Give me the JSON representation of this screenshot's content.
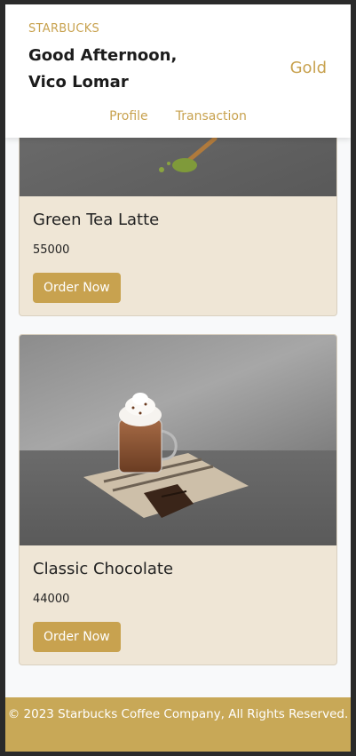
{
  "header": {
    "brand": "STARBUCKS",
    "greeting_line1": "Good Afternoon,",
    "greeting_line2": "Vico Lomar",
    "tier": "Gold",
    "nav": {
      "profile": "Profile",
      "transaction": "Transaction"
    }
  },
  "products": [
    {
      "name": "Green Tea Latte",
      "price": "55000",
      "button": "Order Now"
    },
    {
      "name": "Classic Chocolate",
      "price": "44000",
      "button": "Order Now"
    }
  ],
  "footer": {
    "text": "© 2023 Starbucks Coffee Company, All Rights Reserved."
  },
  "colors": {
    "accent": "#c8a24f",
    "card_bg": "#efe6d6",
    "footer_bg": "#c8a857"
  }
}
